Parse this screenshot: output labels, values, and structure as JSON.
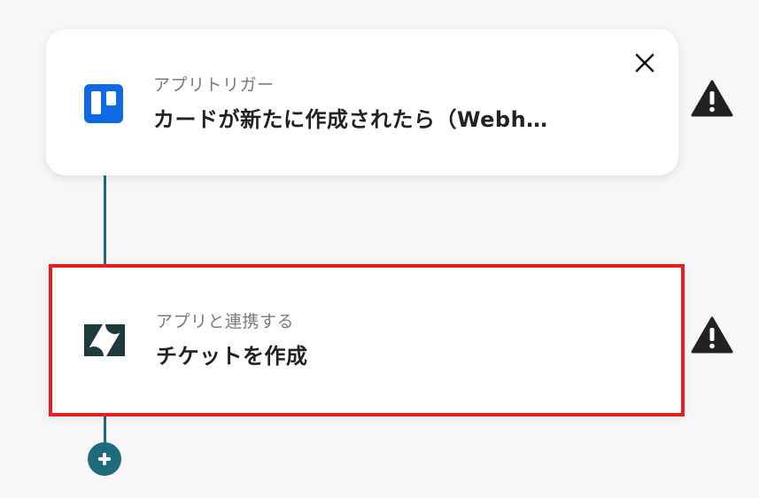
{
  "trigger": {
    "category": "アプリトリガー",
    "title": "カードが新たに作成されたら（Webh…",
    "icon": "trello-icon"
  },
  "action": {
    "category": "アプリと連携する",
    "title": "チケットを作成",
    "icon": "zendesk-icon"
  },
  "colors": {
    "connector": "#1d6b7d",
    "highlight": "#e3201f",
    "trello": "#0d6ae3",
    "zendesk": "#1f3a3d"
  }
}
